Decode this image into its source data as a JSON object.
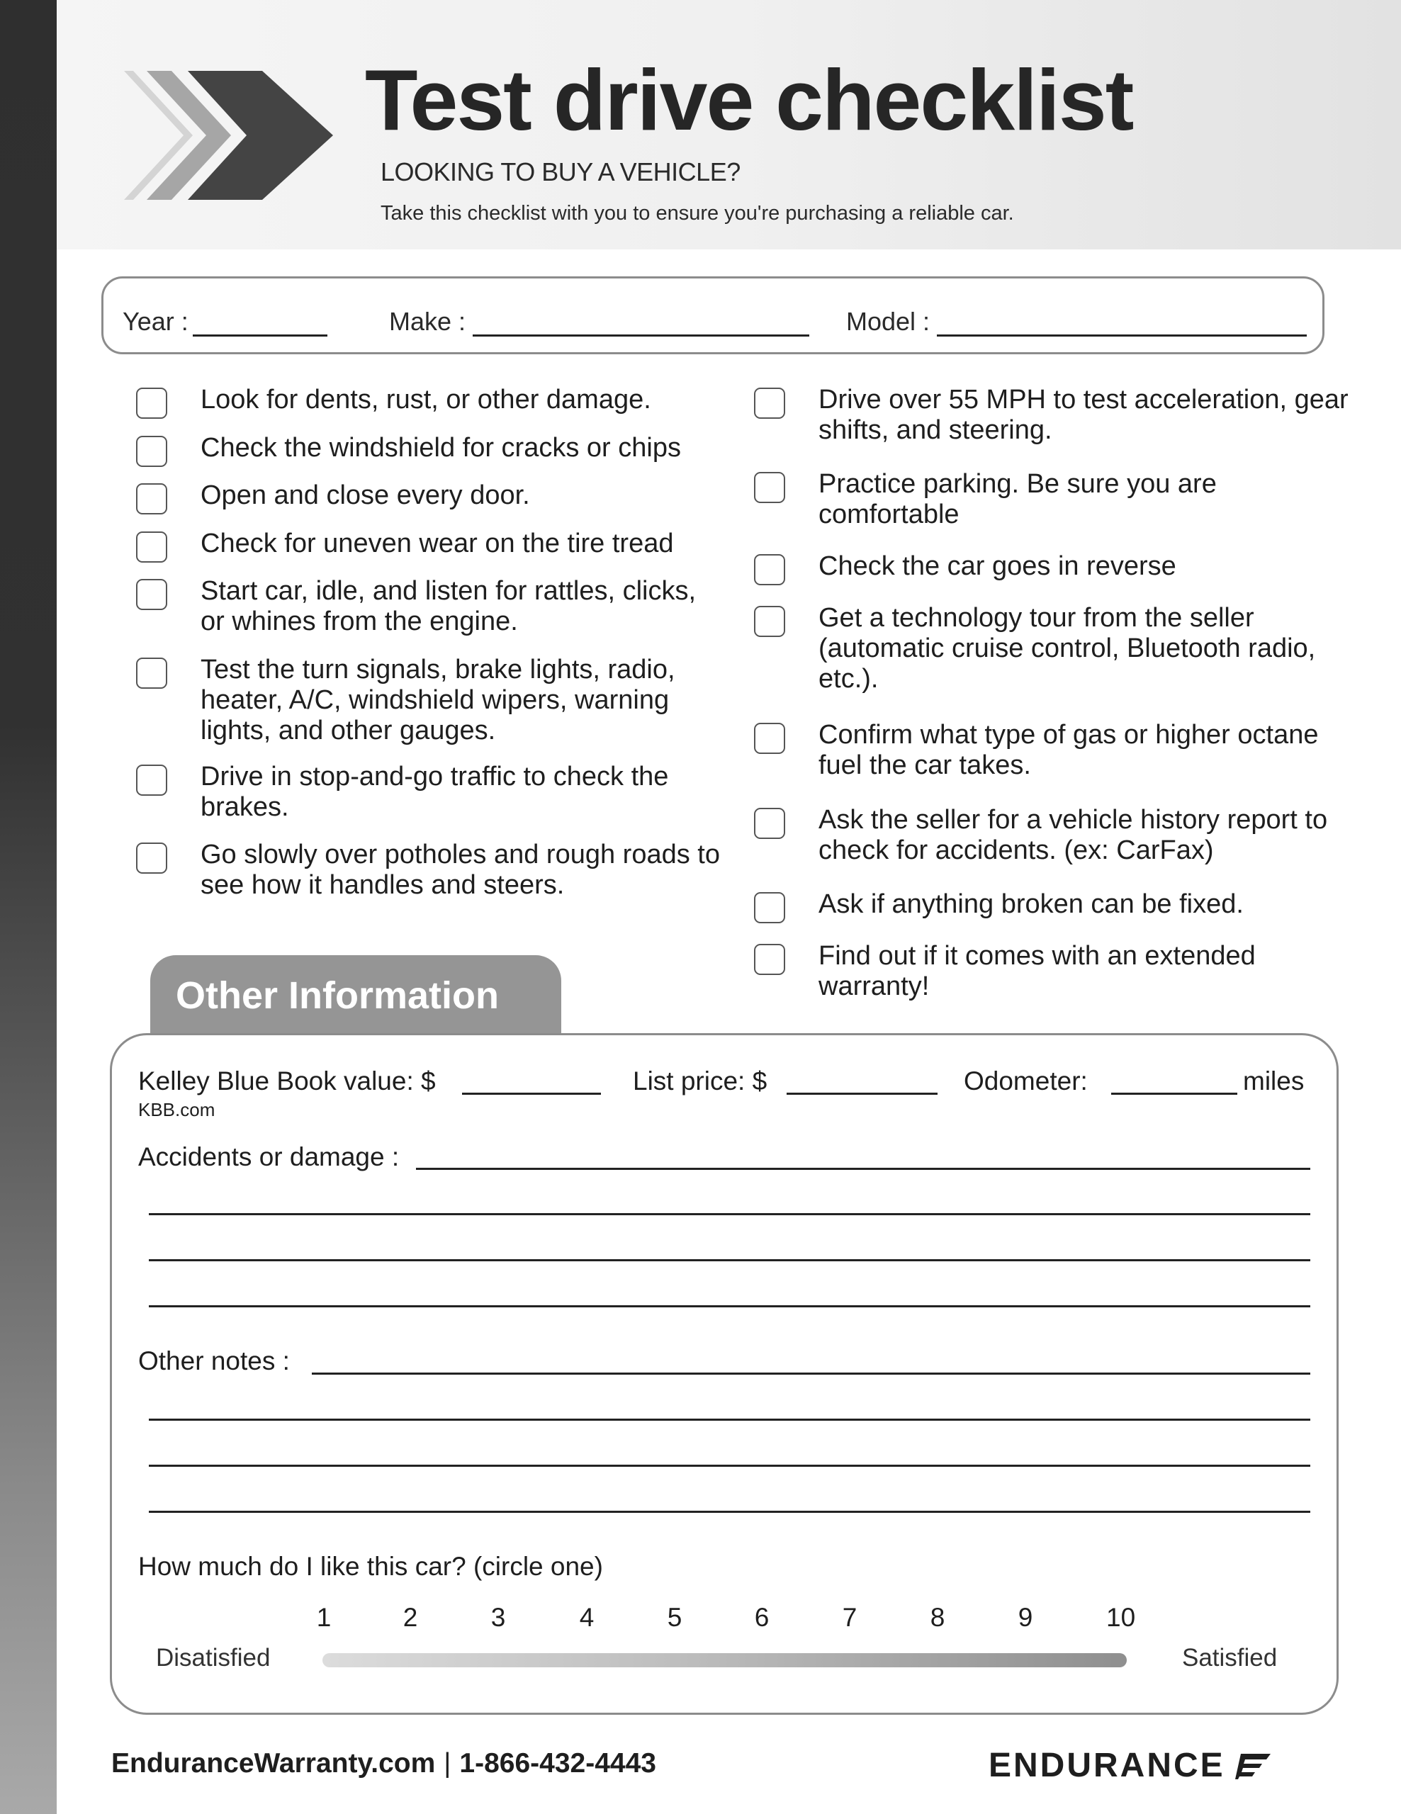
{
  "header": {
    "title": "Test drive checklist",
    "subtitle": "LOOKING TO BUY A VEHICLE?",
    "tagline": "Take this checklist with you to ensure you're purchasing a reliable car."
  },
  "vehicle": {
    "year_label": "Year :",
    "make_label": "Make :",
    "model_label": "Model :",
    "year_value": "",
    "make_value": "",
    "model_value": ""
  },
  "checklist": {
    "left": [
      {
        "text": "Look for dents, rust, or other damage.",
        "checked": false
      },
      {
        "text": "Check the windshield for cracks or chips",
        "checked": false
      },
      {
        "text": "Open and close every door.",
        "checked": false
      },
      {
        "text": "Check for uneven wear on the tire tread",
        "checked": false
      },
      {
        "text": "Start car, idle, and listen for rattles, clicks, or whines from the engine.",
        "checked": false
      },
      {
        "text": "Test the turn signals, brake lights, radio, heater, A/C, windshield wipers, warning lights, and other gauges.",
        "checked": false
      },
      {
        "text": "Drive in stop-and-go traffic to check the brakes.",
        "checked": false
      },
      {
        "text": "Go slowly over potholes and rough roads to see how it handles and steers.",
        "checked": false
      }
    ],
    "right": [
      {
        "text": "Drive over 55 MPH to test acceleration, gear shifts, and steering.",
        "checked": false
      },
      {
        "text": "Practice parking. Be sure you are comfortable",
        "checked": false
      },
      {
        "text": "Check the car goes in reverse",
        "checked": false
      },
      {
        "text": "Get a technology tour from the seller (automatic cruise control, Bluetooth radio, etc.).",
        "checked": false
      },
      {
        "text": "Confirm what type of gas or higher octane fuel the car takes.",
        "checked": false
      },
      {
        "text": "Ask the seller for a vehicle history report to check for accidents. (ex: CarFax)",
        "checked": false
      },
      {
        "text": "Ask if anything broken can be fixed.",
        "checked": false
      },
      {
        "text": "Find out if it comes with an extended warranty!",
        "checked": false
      }
    ]
  },
  "other_info": {
    "tab_label": "Other Information",
    "kbb_label": "Kelley Blue Book value: $",
    "kbb_source": "KBB.com",
    "list_price_label": "List price: $",
    "odometer_label": "Odometer:",
    "odometer_unit": "miles",
    "accidents_label": "Accidents or damage :",
    "other_notes_label": "Other notes :",
    "rating_question": "How much do I like this car? (circle one)",
    "rating_scale": [
      "1",
      "2",
      "3",
      "4",
      "5",
      "6",
      "7",
      "8",
      "9",
      "10"
    ],
    "rating_low_label": "Disatisfied",
    "rating_high_label": "Satisfied"
  },
  "footer": {
    "website": "EnduranceWarranty.com",
    "separator": "|",
    "phone": "1-866-432-4443",
    "brand": "ENDURANCE"
  },
  "colors": {
    "sidebar_top": "#2f2f2f",
    "sidebar_bottom": "#a9a9a9",
    "tab_bg": "#959595",
    "border": "#8c8c8c",
    "chevron_dark": "#444444",
    "chevron_mid": "#a6a6a6",
    "chevron_light": "#d4d4d4"
  }
}
